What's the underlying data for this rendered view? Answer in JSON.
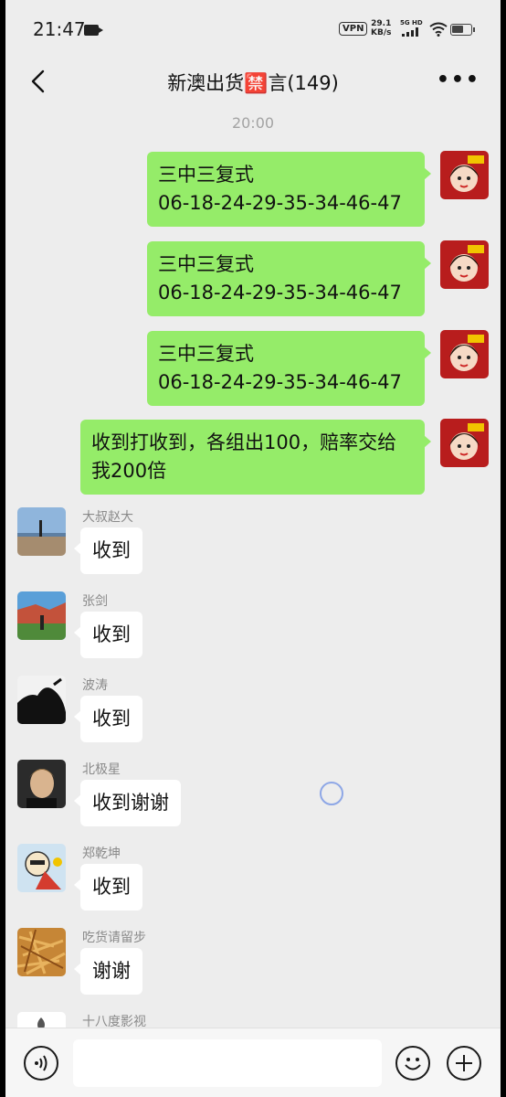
{
  "status_bar": {
    "time": "21:47",
    "vpn": "VPN",
    "net_speed_value": "29.1",
    "net_speed_unit": "KB/s",
    "network_type": "5G HD",
    "battery_level": 0.65
  },
  "header": {
    "title": "新澳出货🈲言(149)",
    "more_label": "•••"
  },
  "timestamp": "20:00",
  "outgoing_messages": [
    {
      "text": "三中三复式\n06-18-24-29-35-34-46-47"
    },
    {
      "text": "三中三复式\n06-18-24-29-35-34-46-47"
    },
    {
      "text": "三中三复式\n06-18-24-29-35-34-46-47"
    },
    {
      "text": "收到打收到，各组出100，赔率交给我200倍"
    }
  ],
  "incoming_messages": [
    {
      "sender": "大叔赵大",
      "text": "收到"
    },
    {
      "sender": "张剑",
      "text": "收到"
    },
    {
      "sender": "波涛",
      "text": "收到"
    },
    {
      "sender": "北极星",
      "text": "收到谢谢"
    },
    {
      "sender": "郑乾坤",
      "text": "收到"
    },
    {
      "sender": "吃货请留步",
      "text": "谢谢"
    },
    {
      "sender": "十八度影视",
      "text": ""
    }
  ],
  "input_bar": {
    "placeholder": ""
  },
  "colors": {
    "background": "#ededed",
    "outgoing_bubble": "#95ec69",
    "incoming_bubble": "#ffffff"
  },
  "icons": [
    "back-icon",
    "more-icon",
    "voice-icon",
    "emoji-icon",
    "plus-icon",
    "wifi-icon",
    "battery-icon",
    "camera-icon"
  ]
}
